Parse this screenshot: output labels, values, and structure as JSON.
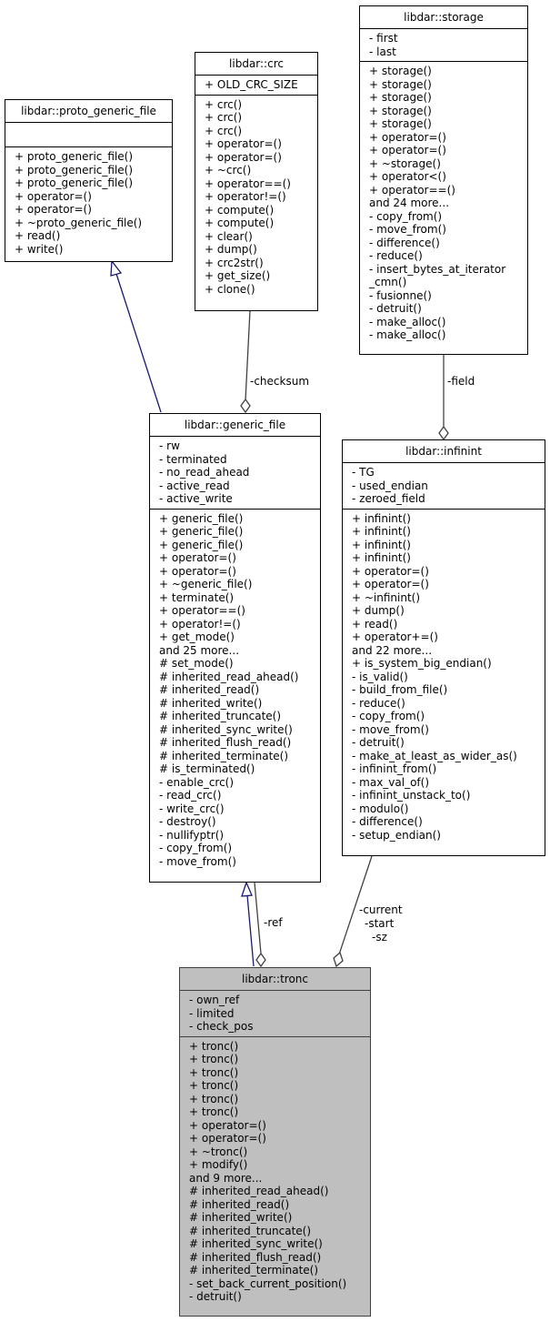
{
  "diagram": {
    "type": "collaboration-graph",
    "classes": {
      "proto_generic_file": {
        "name": "libdar::proto_generic_file",
        "attributes": [],
        "methods": [
          "+ proto_generic_file()",
          "+ proto_generic_file()",
          "+ proto_generic_file()",
          "+ operator=()",
          "+ operator=()",
          "+ ~proto_generic_file()",
          "+ read()",
          "+ write()"
        ]
      },
      "crc": {
        "name": "libdar::crc",
        "attributes": [
          "+ OLD_CRC_SIZE"
        ],
        "methods": [
          "+ crc()",
          "+ crc()",
          "+ crc()",
          "+ operator=()",
          "+ operator=()",
          "+ ~crc()",
          "+ operator==()",
          "+ operator!=()",
          "+ compute()",
          "+ compute()",
          "+ clear()",
          "+ dump()",
          "+ crc2str()",
          "+ get_size()",
          "+ clone()"
        ]
      },
      "storage": {
        "name": "libdar::storage",
        "attributes": [
          "- first",
          "- last"
        ],
        "methods": [
          "+ storage()",
          "+ storage()",
          "+ storage()",
          "+ storage()",
          "+ storage()",
          "+ operator=()",
          "+ operator=()",
          "+ ~storage()",
          "+ operator<()",
          "+ operator==()",
          "and 24 more...",
          "- copy_from()",
          "- move_from()",
          "- difference()",
          "- reduce()",
          "- insert_bytes_at_iterator",
          "_cmn()",
          "- fusionne()",
          "- detruit()",
          "- make_alloc()",
          "- make_alloc()"
        ]
      },
      "generic_file": {
        "name": "libdar::generic_file",
        "attributes": [
          "- rw",
          "- terminated",
          "- no_read_ahead",
          "- active_read",
          "- active_write"
        ],
        "methods": [
          "+ generic_file()",
          "+ generic_file()",
          "+ generic_file()",
          "+ operator=()",
          "+ operator=()",
          "+ ~generic_file()",
          "+ terminate()",
          "+ operator==()",
          "+ operator!=()",
          "+ get_mode()",
          "and 25 more...",
          "# set_mode()",
          "# inherited_read_ahead()",
          "# inherited_read()",
          "# inherited_write()",
          "# inherited_truncate()",
          "# inherited_sync_write()",
          "# inherited_flush_read()",
          "# inherited_terminate()",
          "# is_terminated()",
          "- enable_crc()",
          "- read_crc()",
          "- write_crc()",
          "- destroy()",
          "- nullifyptr()",
          "- copy_from()",
          "- move_from()"
        ]
      },
      "infinint": {
        "name": "libdar::infinint",
        "attributes": [
          "- TG",
          "- used_endian",
          "- zeroed_field"
        ],
        "methods": [
          "+ infinint()",
          "+ infinint()",
          "+ infinint()",
          "+ infinint()",
          "+ operator=()",
          "+ operator=()",
          "+ ~infinint()",
          "+ dump()",
          "+ read()",
          "+ operator+=()",
          "and 22 more...",
          "+ is_system_big_endian()",
          "- is_valid()",
          "- build_from_file()",
          "- reduce()",
          "- copy_from()",
          "- move_from()",
          "- detruit()",
          "- make_at_least_as_wider_as()",
          "- infinint_from()",
          "- max_val_of()",
          "- infinint_unstack_to()",
          "- modulo()",
          "- difference()",
          "- setup_endian()"
        ]
      },
      "tronc": {
        "name": "libdar::tronc",
        "attributes": [
          "- own_ref",
          "- limited",
          "- check_pos"
        ],
        "methods": [
          "+ tronc()",
          "+ tronc()",
          "+ tronc()",
          "+ tronc()",
          "+ tronc()",
          "+ tronc()",
          "+ operator=()",
          "+ operator=()",
          "+ ~tronc()",
          "+ modify()",
          "and 9 more...",
          "# inherited_read_ahead()",
          "# inherited_read()",
          "# inherited_write()",
          "# inherited_truncate()",
          "# inherited_sync_write()",
          "# inherited_flush_read()",
          "# inherited_terminate()",
          "- set_back_current_position()",
          "- detruit()"
        ]
      }
    },
    "edges": [
      {
        "from": "generic_file",
        "to": "proto_generic_file",
        "kind": "inheritance",
        "label": ""
      },
      {
        "from": "generic_file",
        "to": "crc",
        "kind": "aggregation",
        "label": "-checksum"
      },
      {
        "from": "infinint",
        "to": "storage",
        "kind": "aggregation",
        "label": "-field"
      },
      {
        "from": "tronc",
        "to": "generic_file",
        "kind": "inheritance",
        "label": ""
      },
      {
        "from": "tronc",
        "to": "generic_file",
        "kind": "aggregation",
        "label": "-ref"
      },
      {
        "from": "tronc",
        "to": "infinint",
        "kind": "aggregation",
        "label": "-current\n-start\n-sz",
        "label_lines": [
          "-current",
          "-start",
          "-sz"
        ]
      }
    ],
    "colors": {
      "inheritance_edge": "#191970",
      "aggregation_edge": "#404040",
      "focus_class_fill": "#bfbfbf"
    }
  }
}
